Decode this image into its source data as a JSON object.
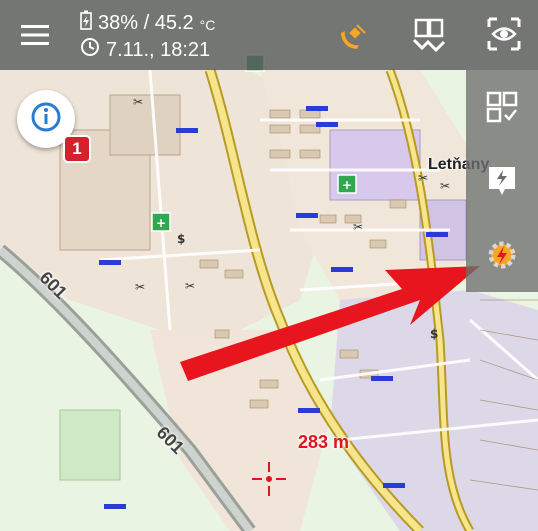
{
  "status": {
    "battery_icon": "battery-icon",
    "battery_temp": "38% / 45.2",
    "temp_unit": "°C",
    "clock_icon": "clock-icon",
    "datetime": "7.11., 18:21"
  },
  "toolbar": {
    "menu_icon": "hamburger-menu-icon",
    "gps_icon": "gps-satellite-icon",
    "map_layers_icon": "map-layers-icon",
    "visibility_icon": "eye-icon"
  },
  "side_tools": {
    "dashboard_icon": "dashboard-grid-icon",
    "flash_icon": "flash-bolt-icon",
    "quick_settings_icon": "gear-bolt-icon"
  },
  "map": {
    "info_icon": "info-icon",
    "notification_count": "1",
    "place_name": "Letňany",
    "road_number_1": "601",
    "road_number_2": "601",
    "distance": "283 m",
    "crosshair_icon": "crosshair-icon",
    "accent_color": "#f5a623",
    "arrow_color": "#e8151f"
  }
}
